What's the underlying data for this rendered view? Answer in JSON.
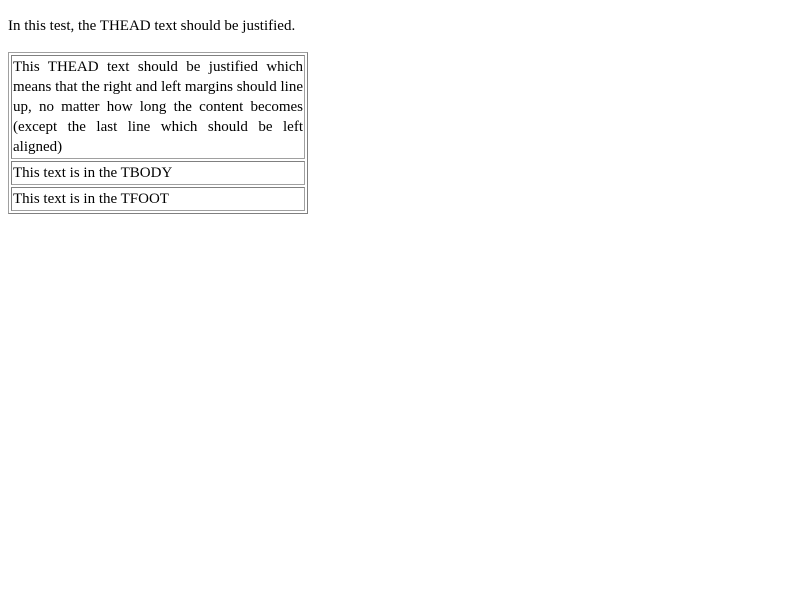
{
  "intro_text": "In this test, the THEAD text should be justified.",
  "table": {
    "thead_text": "This THEAD text should be justified which means that the right and left margins should line up, no matter how long the content becomes (except the last line which should be left aligned)",
    "tbody_text": "This text is in the TBODY",
    "tfoot_text": "This text is in the TFOOT"
  }
}
